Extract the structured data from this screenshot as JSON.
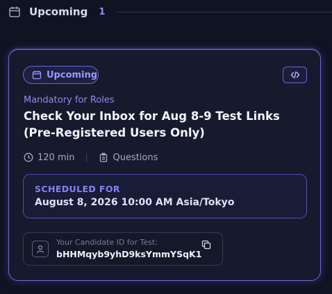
{
  "section": {
    "title": "Upcoming",
    "count": "1"
  },
  "card": {
    "status_label": "Upcoming",
    "kicker": "Mandatory for Roles",
    "title": "Check Your Inbox for Aug 8-9 Test Links (Pre-Registered Users Only)",
    "duration": "120 min",
    "questions_label": "Questions",
    "schedule": {
      "label": "SCHEDULED FOR",
      "value": "August 8, 2026 10:00 AM Asia/Tokyo"
    },
    "candidate": {
      "caption": "Your Candidate ID for Test:",
      "id": "bHHMqyb9yhD9ksYmmYSqK1"
    }
  },
  "icons": {
    "section": "calendar-icon",
    "status": "calendar-icon",
    "embed": "code-icon",
    "duration": "clock-icon",
    "questions": "clipboard-icon",
    "candidate": "user-icon",
    "copy": "copy-icon"
  },
  "colors": {
    "background": "#101322",
    "card": "#161a2c",
    "accent": "#6a68d9",
    "accent_text": "#8b8df2"
  }
}
